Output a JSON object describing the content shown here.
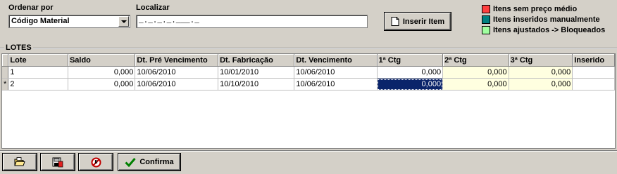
{
  "filter": {
    "order_label": "Ordenar por",
    "order_value": "Código Material",
    "search_label": "Localizar",
    "search_value": "_._._._.___._"
  },
  "insert_button_label": "Inserir Item",
  "legend": [
    {
      "label": "Itens sem preço médio",
      "color": "#ff4040"
    },
    {
      "label": "Itens inseridos manualmente",
      "color": "#008080"
    },
    {
      "label": "Itens ajustados -> Bloqueados",
      "color": "#a0ffa0"
    }
  ],
  "group_title": "LOTES",
  "table": {
    "columns": [
      "Lote",
      "Saldo",
      "Dt. Pré Vencimento",
      "Dt. Fabricação",
      "Dt. Vencimento",
      "1ª Ctg",
      "2ª Ctg",
      "3ª Ctg",
      "Inserido"
    ],
    "rows": [
      {
        "indicator": "",
        "lote": "1",
        "saldo": "0,000",
        "pre_venc": "10/06/2010",
        "fabricacao": "10/01/2010",
        "vencimento": "10/06/2010",
        "ctg1": "0,000",
        "ctg2": "0,000",
        "ctg3": "0,000",
        "inserido": ""
      },
      {
        "indicator": "*",
        "lote": "2",
        "saldo": "0,000",
        "pre_venc": "10/06/2010",
        "fabricacao": "10/10/2010",
        "vencimento": "10/06/2010",
        "ctg1": "0,000",
        "ctg2": "0,000",
        "ctg3": "0,000",
        "inserido": ""
      }
    ]
  },
  "toolbar": {
    "confirm_label": "Confirma",
    "icons": [
      "open-folder-icon",
      "save-disk-icon",
      "cancel-icon",
      "checkmark-icon"
    ]
  }
}
